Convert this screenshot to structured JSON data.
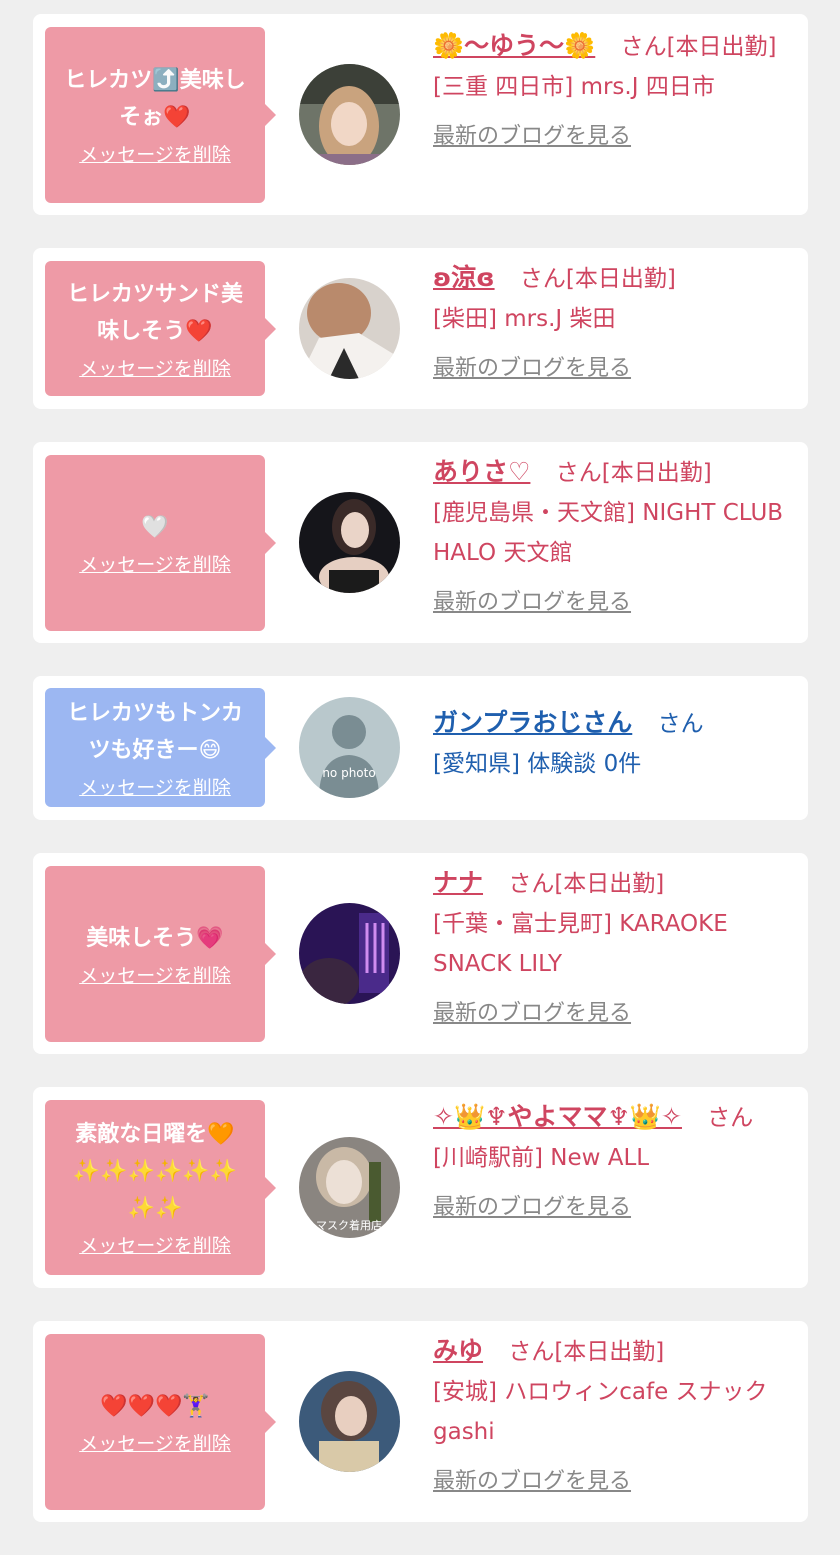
{
  "delete_label": "メッセージを削除",
  "blog_label": "最新のブログを見る",
  "entries": [
    {
      "message": "ヒレカツ⤴️美味し\nそぉ❤️",
      "name": "🌼〜ゆう〜🌼",
      "suffix": "さん[本日出勤]",
      "shop": "[三重 四日市] mrs.J 四日市"
    },
    {
      "message": "ヒレカツサンド美\n味しそう❤️",
      "name": "ʚ涼ɞ",
      "suffix": "さん[本日出勤]",
      "shop": "[柴田] mrs.J 柴田"
    },
    {
      "message": "🤍",
      "name": "ありさ♡",
      "suffix": "さん[本日出勤]",
      "shop": "[鹿児島県・天文館] NIGHT CLUB HALO 天文館"
    },
    {
      "message": "ヒレカツもトンカ\nツも好きー😄",
      "name": "ガンプラおじさん",
      "suffix": "さん",
      "shop": "[愛知県] 体験談 0件",
      "avatar_text": "no photo"
    },
    {
      "message": "美味しそう💗",
      "name": "ナナ",
      "suffix": "さん[本日出勤]",
      "shop": "[千葉・富士見町] KARAOKE SNACK LILY"
    },
    {
      "message": "素敵な日曜を🧡\n✨✨✨✨✨✨\n✨✨",
      "name": "✧👑♆やよママ♆👑✧",
      "suffix": "さん",
      "shop": "[川崎駅前] New ALL",
      "avatar_text": "マスク着用店"
    },
    {
      "message": "❤️❤️❤️🏋️‍♀️",
      "name": "みゆ",
      "suffix": "さん[本日出勤]",
      "shop": "[安城] ハロウィンcafe スナックgashi"
    }
  ]
}
